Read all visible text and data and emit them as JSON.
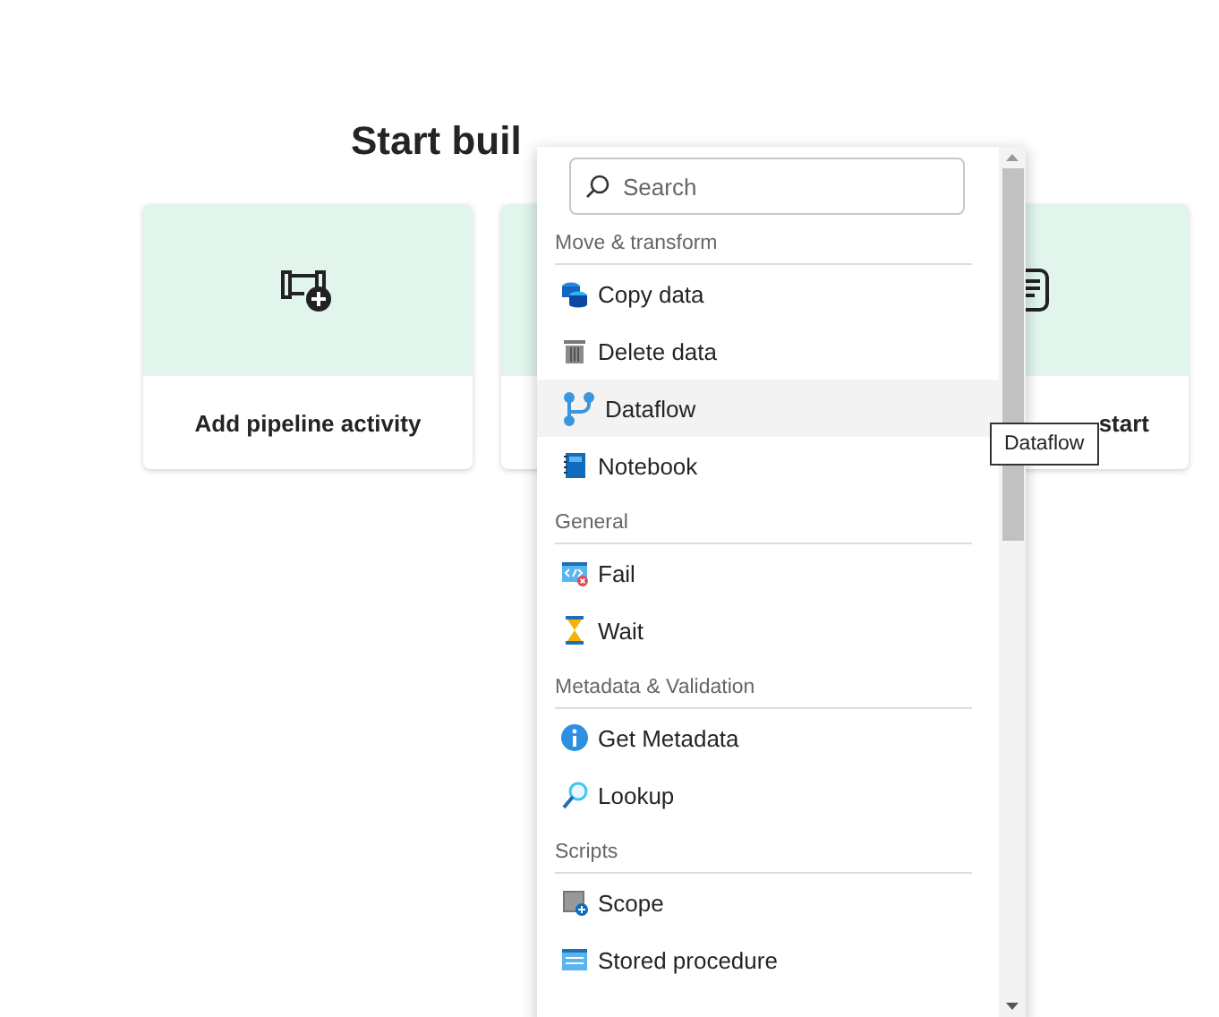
{
  "heading": "Start buil",
  "cards": [
    {
      "kind": "pipeline",
      "label": "Add pipeline activity"
    },
    {
      "kind": "blank"
    },
    {
      "kind": "document",
      "label": "start"
    }
  ],
  "menu": {
    "search": {
      "placeholder": "Search"
    },
    "sections": [
      {
        "title": "Move & transform",
        "items": [
          {
            "kind": "copy",
            "label": "Copy data",
            "selected": false
          },
          {
            "kind": "delete",
            "label": "Delete data",
            "selected": false
          },
          {
            "kind": "dataflow",
            "label": "Dataflow",
            "selected": true
          },
          {
            "kind": "notebook",
            "label": "Notebook",
            "selected": false
          }
        ]
      },
      {
        "title": "General",
        "items": [
          {
            "kind": "fail",
            "label": "Fail",
            "selected": false
          },
          {
            "kind": "wait",
            "label": "Wait",
            "selected": false
          }
        ]
      },
      {
        "title": "Metadata & Validation",
        "items": [
          {
            "kind": "info",
            "label": "Get Metadata",
            "selected": false
          },
          {
            "kind": "lookup",
            "label": "Lookup",
            "selected": false
          }
        ]
      },
      {
        "title": "Scripts",
        "items": [
          {
            "kind": "scope",
            "label": "Scope",
            "selected": false
          },
          {
            "kind": "stored",
            "label": "Stored procedure",
            "selected": false
          }
        ]
      }
    ]
  },
  "tooltip": "Dataflow"
}
